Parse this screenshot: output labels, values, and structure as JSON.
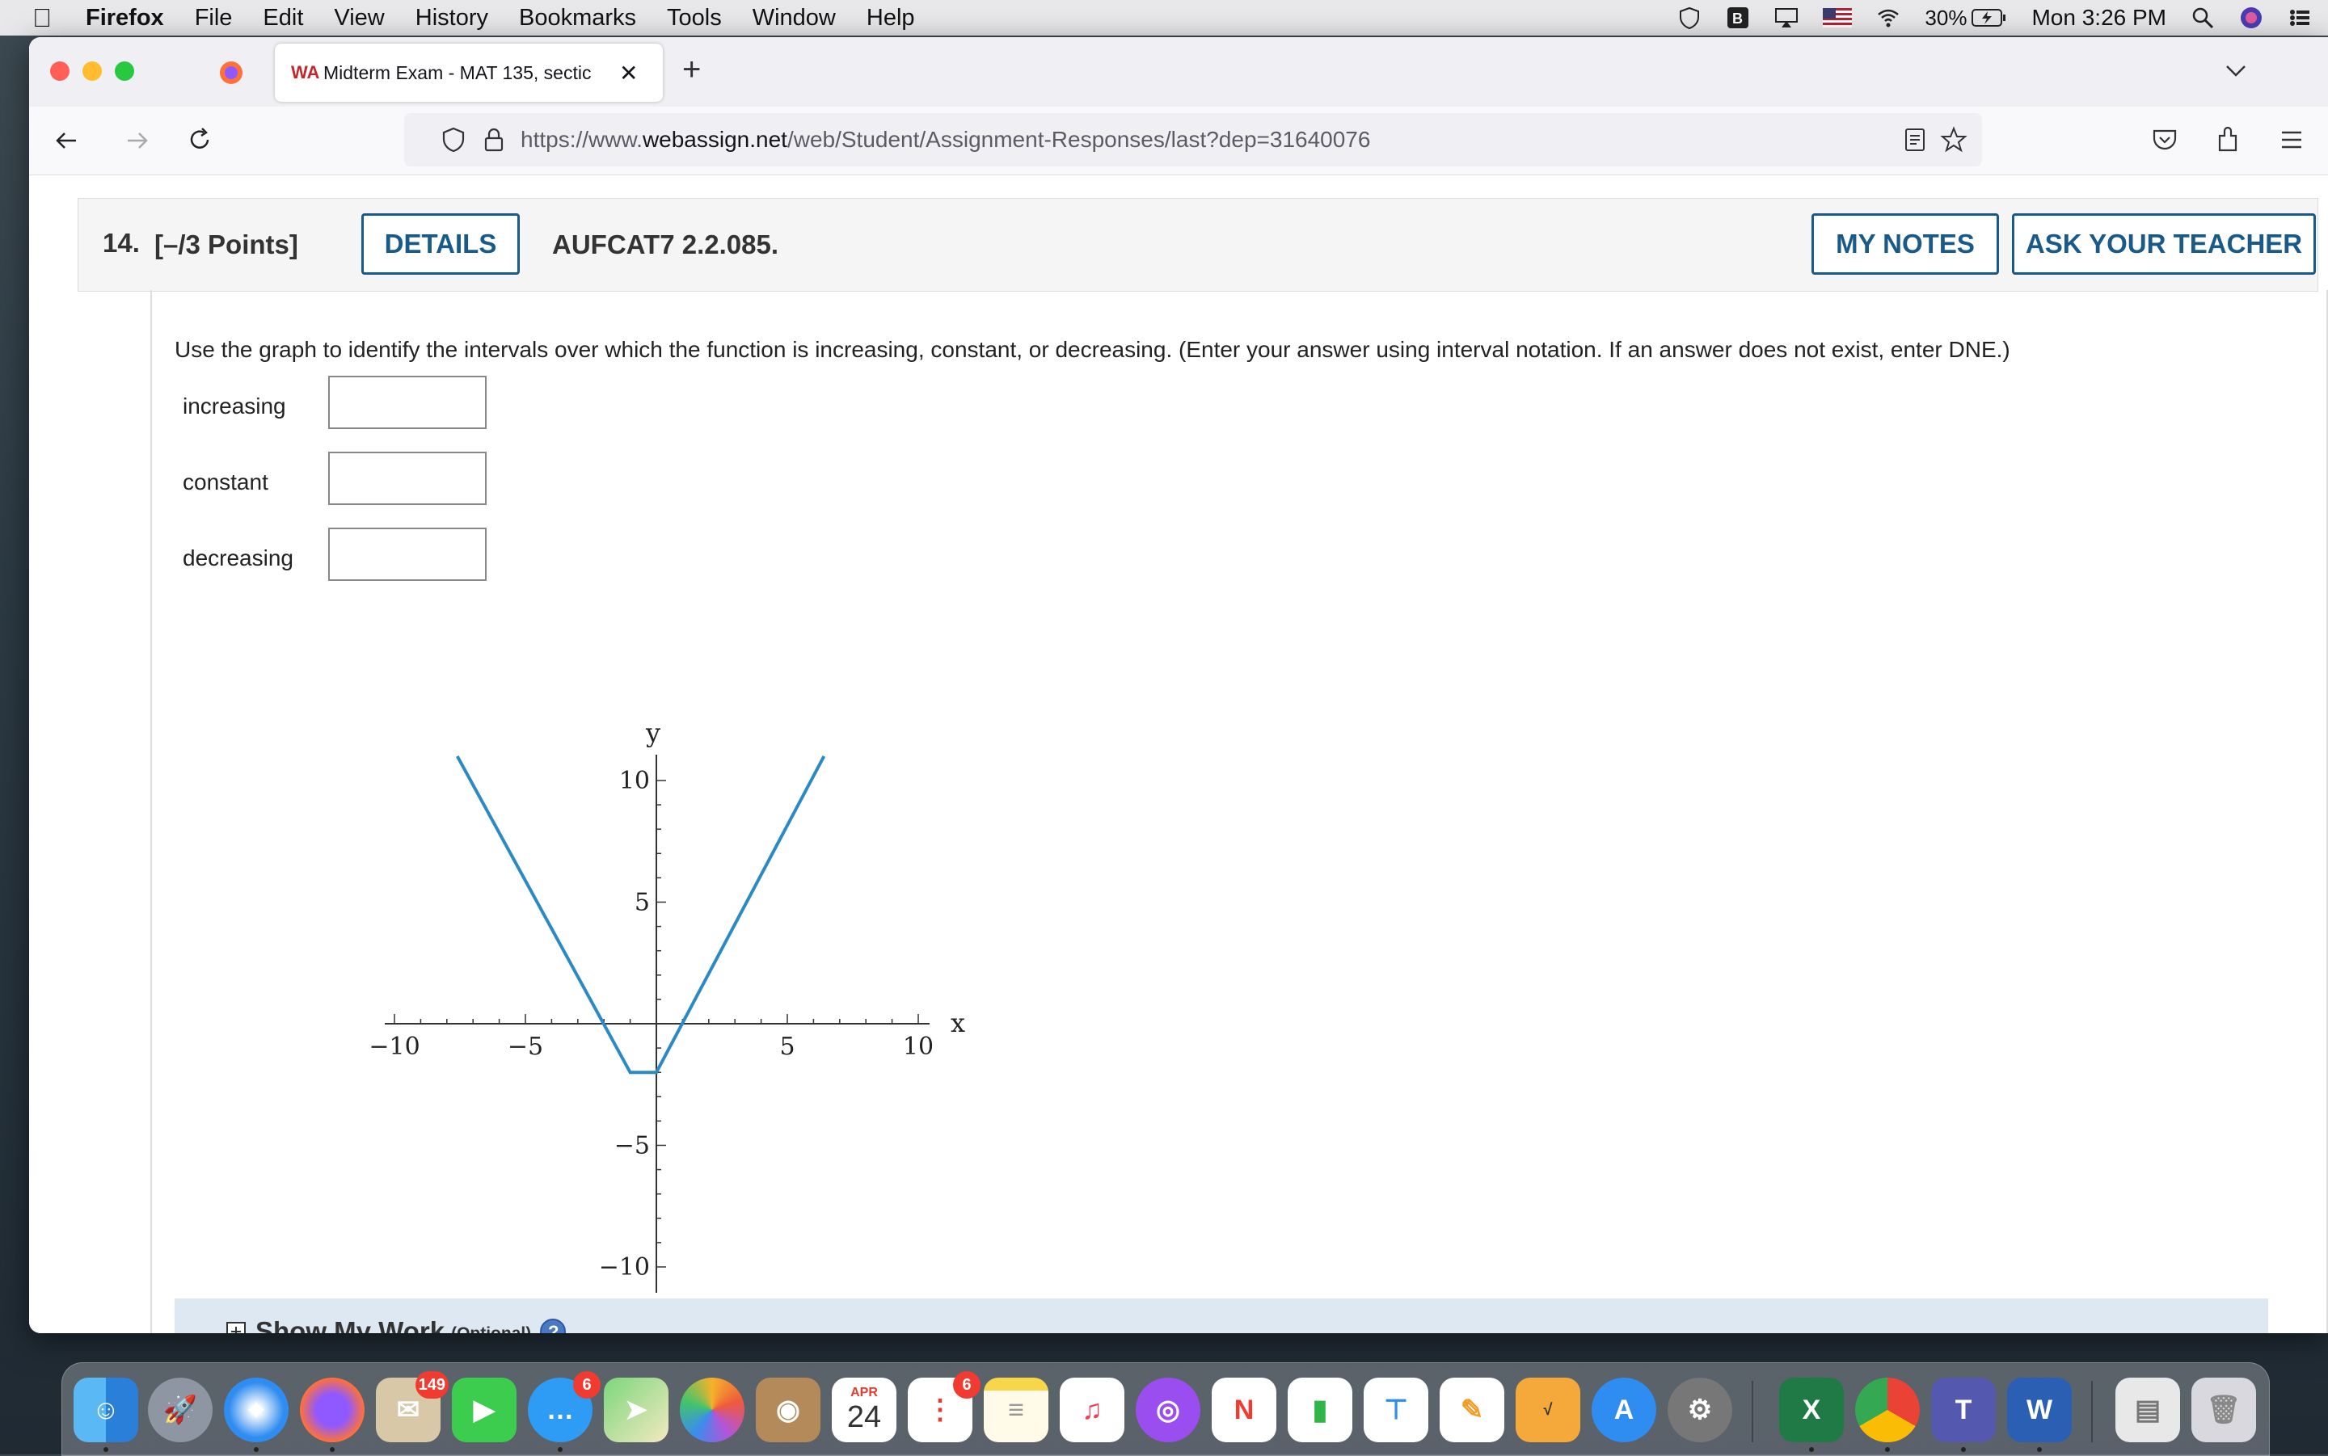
{
  "menubar": {
    "app_name": "Firefox",
    "menus": [
      "File",
      "Edit",
      "View",
      "History",
      "Bookmarks",
      "Tools",
      "Window",
      "Help"
    ],
    "battery": "30%",
    "clock": "Mon 3:26 PM"
  },
  "browser": {
    "tab_title": "Midterm Exam - MAT 135, sectic",
    "url_prefix": "https://www.",
    "url_host": "webassign.net",
    "url_path": "/web/Student/Assignment-Responses/last?dep=31640076"
  },
  "question": {
    "number": "14.",
    "points": "[–/3 Points]",
    "details_label": "DETAILS",
    "code": "AUFCAT7 2.2.085.",
    "my_notes_label": "MY NOTES",
    "ask_teacher_label": "ASK YOUR TEACHER",
    "prompt": "Use the graph to identify the intervals over which the function is increasing, constant, or decreasing. (Enter your answer using interval notation. If an answer does not exist, enter DNE.)",
    "answers": [
      {
        "label": "increasing",
        "value": ""
      },
      {
        "label": "constant",
        "value": ""
      },
      {
        "label": "decreasing",
        "value": ""
      }
    ],
    "show_work_label": "Show My Work",
    "show_work_optional": "(Optional)"
  },
  "chart_data": {
    "type": "line",
    "xlabel": "x",
    "ylabel": "y",
    "xlim": [
      -10,
      10
    ],
    "ylim": [
      -10,
      10
    ],
    "xticks": [
      "−10",
      "−5",
      "5",
      "10"
    ],
    "yticks": [
      "10",
      "5",
      "−5",
      "−10"
    ],
    "x_tick_values": [
      -10,
      -5,
      5,
      10
    ],
    "y_tick_values": [
      10,
      5,
      -5,
      -10
    ],
    "series": [
      {
        "x": [
          -7.6,
          -1,
          0,
          6.4
        ],
        "y": [
          11,
          -2,
          -2,
          11
        ]
      }
    ],
    "grid": false,
    "color": "#2b8ac6"
  },
  "dock": {
    "mail_badge": "149",
    "messages_badge": "6",
    "reminders_badge": "6",
    "calendar_month": "APR",
    "calendar_day": "24"
  }
}
